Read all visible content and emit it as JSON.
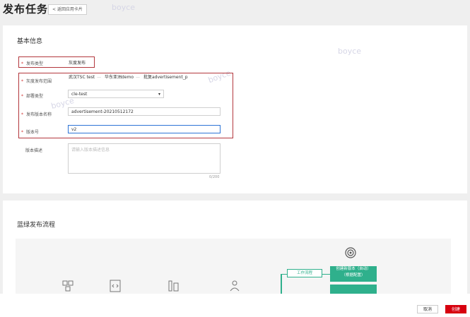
{
  "header": {
    "title": "发布任务",
    "back_label": "< 返回应用卡片"
  },
  "watermark": "boyce",
  "basic": {
    "section_title": "基本信息",
    "release_type": {
      "label": "发布类型",
      "value": "灰度发布"
    },
    "target": {
      "label": "灰度发布范围",
      "options": [
        "武汉TSC test",
        "华东亚洲demo",
        "批复advertisement_p"
      ]
    },
    "deploy_env": {
      "label": "部署类型",
      "value": "cle-test"
    },
    "version_name": {
      "label": "发布版本名称",
      "value": "advertisement-20210512172"
    },
    "version_no": {
      "label": "版本号",
      "value": "v2"
    },
    "description": {
      "label": "版本描述",
      "placeholder": "请输入版本描述信息",
      "counter": "0/200"
    }
  },
  "flow": {
    "section_title": "蓝绿发布流程",
    "tag_label": "工作流程",
    "step_label": "创建新版本（自动）",
    "step_sub": "（根据配置）"
  },
  "footer": {
    "cancel_label": "取消",
    "create_label": "创建"
  }
}
